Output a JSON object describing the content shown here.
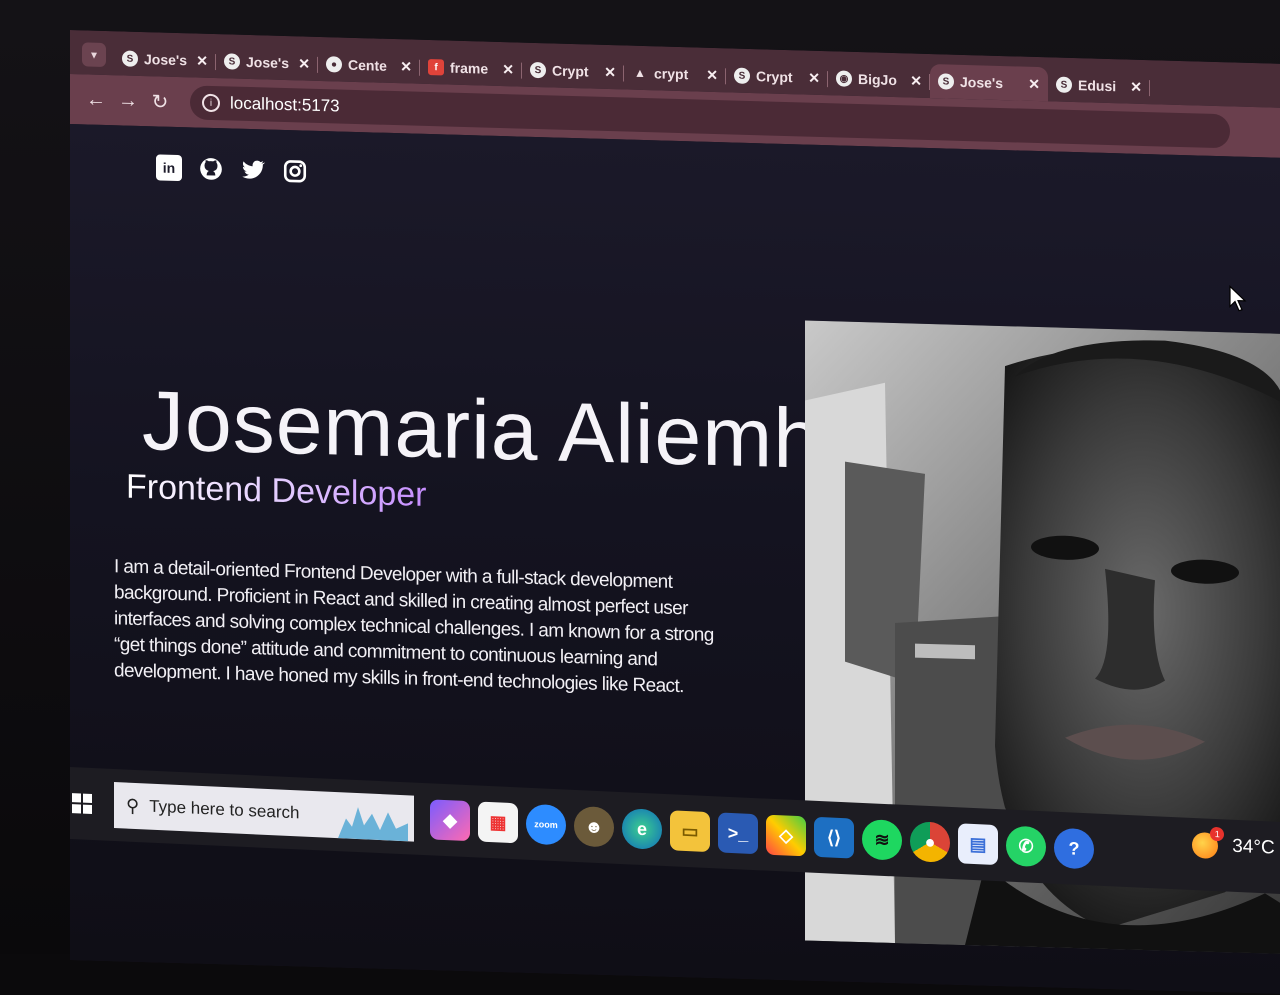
{
  "browser": {
    "tabs": [
      {
        "title": "Jose's",
        "icon": "site-icon"
      },
      {
        "title": "Jose's",
        "icon": "site-icon"
      },
      {
        "title": "Cente",
        "icon": "site-icon"
      },
      {
        "title": "frame",
        "icon": "framer-icon"
      },
      {
        "title": "Crypt",
        "icon": "site-icon"
      },
      {
        "title": "crypt",
        "icon": "triangle-icon"
      },
      {
        "title": "Crypt",
        "icon": "site-icon"
      },
      {
        "title": "BigJo",
        "icon": "github-icon"
      },
      {
        "title": "Jose's",
        "icon": "site-icon",
        "active": true
      },
      {
        "title": "Edusi",
        "icon": "site-icon"
      }
    ],
    "address": "localhost:5173",
    "accent": "#6a3f4d"
  },
  "page": {
    "socials": [
      "linkedin-icon",
      "github-icon",
      "twitter-icon",
      "instagram-icon"
    ],
    "name": "Josemaria Aliemhe",
    "role": "Frontend Developer",
    "bio": "I am a detail-oriented Frontend Developer with a full-stack development background. Proficient in React and skilled in creating almost perfect user interfaces and solving complex technical challenges. I am known for a strong “get things done” attitude and commitment to continuous learning and development. I have honed my skills in front-end technologies like React."
  },
  "taskbar": {
    "search_placeholder": "Type here to search",
    "apps": [
      "copilot-icon",
      "store-icon",
      "zoom-icon",
      "avatar-icon",
      "edge-icon",
      "file-explorer-icon",
      "powershell-icon",
      "app-icon",
      "vscode-icon",
      "spotify-icon",
      "chrome-icon",
      "docs-icon",
      "whatsapp-icon",
      "help-icon"
    ],
    "temperature": "34°C",
    "weather_badge": "1"
  }
}
